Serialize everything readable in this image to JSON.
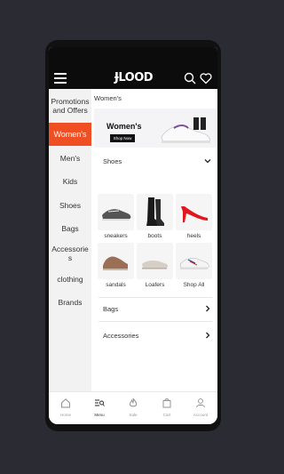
{
  "header": {
    "logo": "ɈLOOD",
    "menu_icon": "hamburger-icon",
    "search_icon": "search-icon",
    "wishlist_icon": "heart-icon"
  },
  "sidebar": {
    "items": [
      {
        "label": "Promotions and Offers"
      },
      {
        "label": "Women's",
        "active": true
      },
      {
        "label": "Men's"
      },
      {
        "label": "Kids"
      },
      {
        "label": "Shoes"
      },
      {
        "label": "Bags"
      },
      {
        "label": "Accessories"
      },
      {
        "label": "clothing"
      },
      {
        "label": "Brands"
      }
    ]
  },
  "main": {
    "breadcrumb": "Women's",
    "banner": {
      "title": "Women's",
      "button": "Shop Now"
    },
    "shoes_section": {
      "label": "Shoes",
      "icon": "chevron-down-icon"
    },
    "tiles": [
      {
        "label": "sneakers"
      },
      {
        "label": "boots"
      },
      {
        "label": "heels"
      },
      {
        "label": "sandals"
      },
      {
        "label": "Loafers"
      },
      {
        "label": "Shop All"
      }
    ],
    "bags_section": {
      "label": "Bags",
      "icon": "chevron-right-icon"
    },
    "accessories_section": {
      "label": "Accessories",
      "icon": "chevron-right-icon"
    }
  },
  "navbar": {
    "items": [
      {
        "label": "Home",
        "icon": "home-icon"
      },
      {
        "label": "Menu",
        "icon": "menu-search-icon",
        "active": true
      },
      {
        "label": "Sale",
        "icon": "flame-icon"
      },
      {
        "label": "Cart",
        "icon": "cart-icon"
      },
      {
        "label": "Account",
        "icon": "user-icon"
      }
    ]
  },
  "colors": {
    "accent": "#f04e23",
    "topbar": "#0c0c0c",
    "background": "#2b2b33"
  }
}
